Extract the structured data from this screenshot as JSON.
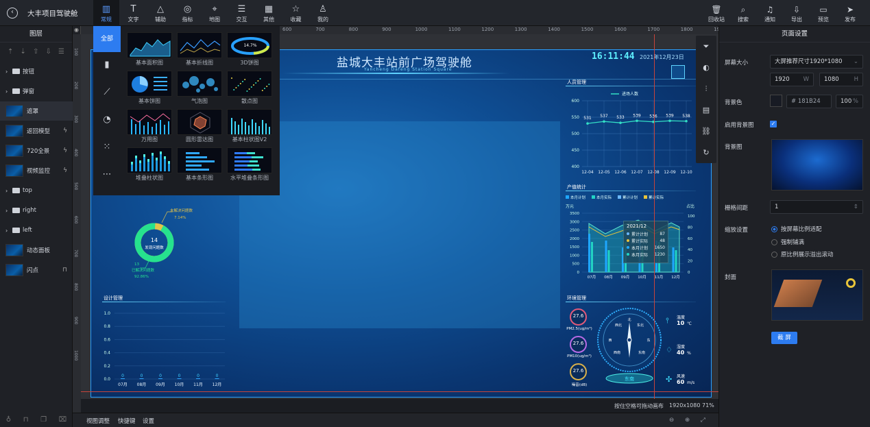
{
  "topbar": {
    "project_title": "大丰项目驾驶舱",
    "tools": [
      {
        "label": "常规",
        "icon": "bar-chart-icon",
        "glyph": "▥"
      },
      {
        "label": "文字",
        "icon": "text-icon",
        "glyph": "T"
      },
      {
        "label": "辅助",
        "icon": "shapes-icon",
        "glyph": "△"
      },
      {
        "label": "指标",
        "icon": "indicator-icon",
        "glyph": "◎"
      },
      {
        "label": "地图",
        "icon": "map-pin-icon",
        "glyph": "⌖"
      },
      {
        "label": "交互",
        "icon": "sliders-icon",
        "glyph": "☰"
      },
      {
        "label": "其他",
        "icon": "grid-icon",
        "glyph": "▦"
      },
      {
        "label": "收藏",
        "icon": "star-icon",
        "glyph": "☆"
      },
      {
        "label": "我的",
        "icon": "user-icon",
        "glyph": "♙"
      }
    ],
    "right_tools": [
      {
        "label": "回收站",
        "icon": "trash-icon",
        "glyph": "🗑"
      },
      {
        "label": "搜索",
        "icon": "search-icon",
        "glyph": "⌕"
      },
      {
        "label": "通知",
        "icon": "bell-icon",
        "glyph": "♫"
      },
      {
        "label": "导出",
        "icon": "export-icon",
        "glyph": "⇩"
      },
      {
        "label": "预览",
        "icon": "preview-icon",
        "glyph": "▭"
      },
      {
        "label": "发布",
        "icon": "send-icon",
        "glyph": "➤"
      }
    ]
  },
  "layers": {
    "title": "图层",
    "items": [
      {
        "label": "按钮",
        "type": "folder"
      },
      {
        "label": "弹窗",
        "type": "folder"
      },
      {
        "label": "遮罩",
        "type": "thumb",
        "selected": true
      },
      {
        "label": "返回模型",
        "type": "thumb",
        "tail": "ϟ"
      },
      {
        "label": "720全景",
        "type": "thumb",
        "tail": "ϟ"
      },
      {
        "label": "视频监控",
        "type": "thumb",
        "tail": "ϟ"
      },
      {
        "label": "top",
        "type": "folder"
      },
      {
        "label": "right",
        "type": "folder"
      },
      {
        "label": "left",
        "type": "folder"
      },
      {
        "label": "动态面板",
        "type": "thumb"
      },
      {
        "label": "闪点",
        "type": "thumb",
        "tail": "🔒"
      }
    ]
  },
  "palette": {
    "side": [
      {
        "label": "全部",
        "icon": "all-icon"
      },
      {
        "label": "",
        "icon": "bar-chart-icon",
        "glyph": "▮"
      },
      {
        "label": "",
        "icon": "line-chart-icon",
        "glyph": "⟋"
      },
      {
        "label": "",
        "icon": "pie-chart-icon",
        "glyph": "◔"
      },
      {
        "label": "",
        "icon": "scatter-chart-icon",
        "glyph": "⁙"
      },
      {
        "label": "",
        "icon": "more-icon",
        "glyph": "⋯"
      }
    ],
    "cells": [
      "基本面积图",
      "基本折线图",
      "3D饼图",
      "基本饼图",
      "气泡图",
      "散点图",
      "万用图",
      "圆形雷达图",
      "基本柱状图V2",
      "堆叠柱状图",
      "基本条形图",
      "水平堆叠条形图"
    ],
    "pie3d_label": "14.7%"
  },
  "ruler": {
    "ticks": [
      "600",
      "700",
      "800",
      "900",
      "1000",
      "1100",
      "1200",
      "1300",
      "1400",
      "1500",
      "1600",
      "1700",
      "1800",
      "1900"
    ],
    "left_ticks": [
      "100",
      "200",
      "300",
      "400",
      "500",
      "600",
      "700",
      "800",
      "900",
      "1000"
    ]
  },
  "dashboard": {
    "title": "盐城大丰站前广场驾驶舱",
    "subtitle": "Yancheng Dafeng Station Square",
    "clock": "16:11:44",
    "date": "2021年12月23日",
    "person_panel": "人员管理",
    "person_legend": "进场人数",
    "person_chart": {
      "type": "line",
      "categories": [
        "12-04",
        "12-05",
        "12-06",
        "12-07",
        "12-08",
        "12-09",
        "12-10"
      ],
      "values": [
        531,
        537,
        533,
        539,
        536,
        539,
        538
      ],
      "ylim": [
        400,
        600
      ],
      "yticks": [
        "600",
        "550",
        "500",
        "450",
        "400"
      ]
    },
    "output_panel": "产值统计",
    "output_legend": [
      "本月计划",
      "本月实际",
      "累计计划",
      "累计实际"
    ],
    "output_chart": {
      "categories": [
        "07月",
        "08月",
        "09月",
        "10月",
        "11月",
        "12月"
      ],
      "y_unit_left": "万元",
      "y_unit_right": "占比",
      "left_ticks": [
        "3500",
        "3000",
        "2500",
        "2000",
        "1500",
        "1000",
        "500",
        "0"
      ],
      "right_ticks": [
        "100",
        "80",
        "60",
        "40",
        "20",
        "0"
      ]
    },
    "tooltip": {
      "title": "2021/12",
      "rows": [
        {
          "name": "累计计划",
          "value": "87"
        },
        {
          "name": "累计实际",
          "value": "48"
        },
        {
          "name": "本月计划",
          "value": "1650"
        },
        {
          "name": "本月实际",
          "value": "1230"
        }
      ]
    },
    "env_panel": "环境管理",
    "env_gauges": [
      {
        "value": "27.6",
        "label": "PM2.5(ug/m³)"
      },
      {
        "value": "27.6",
        "label": "PM10(ug/m³)"
      },
      {
        "value": "27.6",
        "label": "噪音(dB)"
      }
    ],
    "compass": {
      "north": "北",
      "ne": "东北",
      "nw": "西北",
      "east": "东",
      "west": "西",
      "se": "东南",
      "sw": "西南",
      "south": "南"
    },
    "compass_dir": "东南",
    "weather": [
      {
        "label": "温度",
        "value": "10",
        "unit": "℃"
      },
      {
        "label": "湿度",
        "value": "40",
        "unit": "%"
      },
      {
        "label": "风速",
        "value": "60",
        "unit": "m/s"
      }
    ],
    "donut": {
      "center_value": "14",
      "center_label": "发现问题数",
      "top_label": "未解决问题数",
      "top_pct": "7.14%",
      "bottom_count": "13",
      "bottom_label": "已解决问题数",
      "bottom_pct": "92.86%",
      "solved_fraction": 0.9286
    },
    "design_panel": "设计管理",
    "design_chart": {
      "type": "bar",
      "categories": [
        "07月",
        "08月",
        "09月",
        "10月",
        "11月",
        "12月"
      ],
      "values": [
        0,
        0,
        0,
        0,
        0,
        0
      ],
      "yticks": [
        "1.0",
        "0.8",
        "0.6",
        "0.4",
        "0.2",
        "0.0"
      ],
      "ylim": [
        0,
        1
      ]
    }
  },
  "bottombar": {
    "items": [
      "视图调整",
      "快捷键",
      "设置"
    ],
    "hint": "按住空格可拖动画布",
    "size": "1920x1080 71%"
  },
  "settings": {
    "title": "页面设置",
    "screen_size_label": "屏幕大小",
    "screen_size_value": "大屏推荐尺寸1920*1080",
    "width": "1920",
    "width_unit": "W",
    "height": "1080",
    "height_unit": "H",
    "bg_color_label": "背景色",
    "bg_color_value": "# 181B24",
    "bg_opacity": "100",
    "bg_opacity_unit": "%",
    "use_bg_image_label": "启用背景图",
    "bg_image_label": "背景图",
    "grid_gap_label": "栅格间距",
    "grid_gap_value": "1",
    "scale_label": "缩放设置",
    "scale_options": [
      "按屏幕比例适配",
      "强制铺满",
      "原比例展示溢出滚动"
    ],
    "cover_label": "封面",
    "capture_button": "截 屏"
  },
  "vtool_icons": [
    "filter-icon",
    "palette-icon",
    "adjust-icon",
    "layout-icon",
    "link-icon",
    "refresh-icon"
  ],
  "colors": {
    "accent": "#2d7cf0",
    "panel": "#1f2126",
    "screen_bg": "#0f4f95",
    "cyan": "#2ee6d6",
    "gold": "#e8c43a"
  }
}
